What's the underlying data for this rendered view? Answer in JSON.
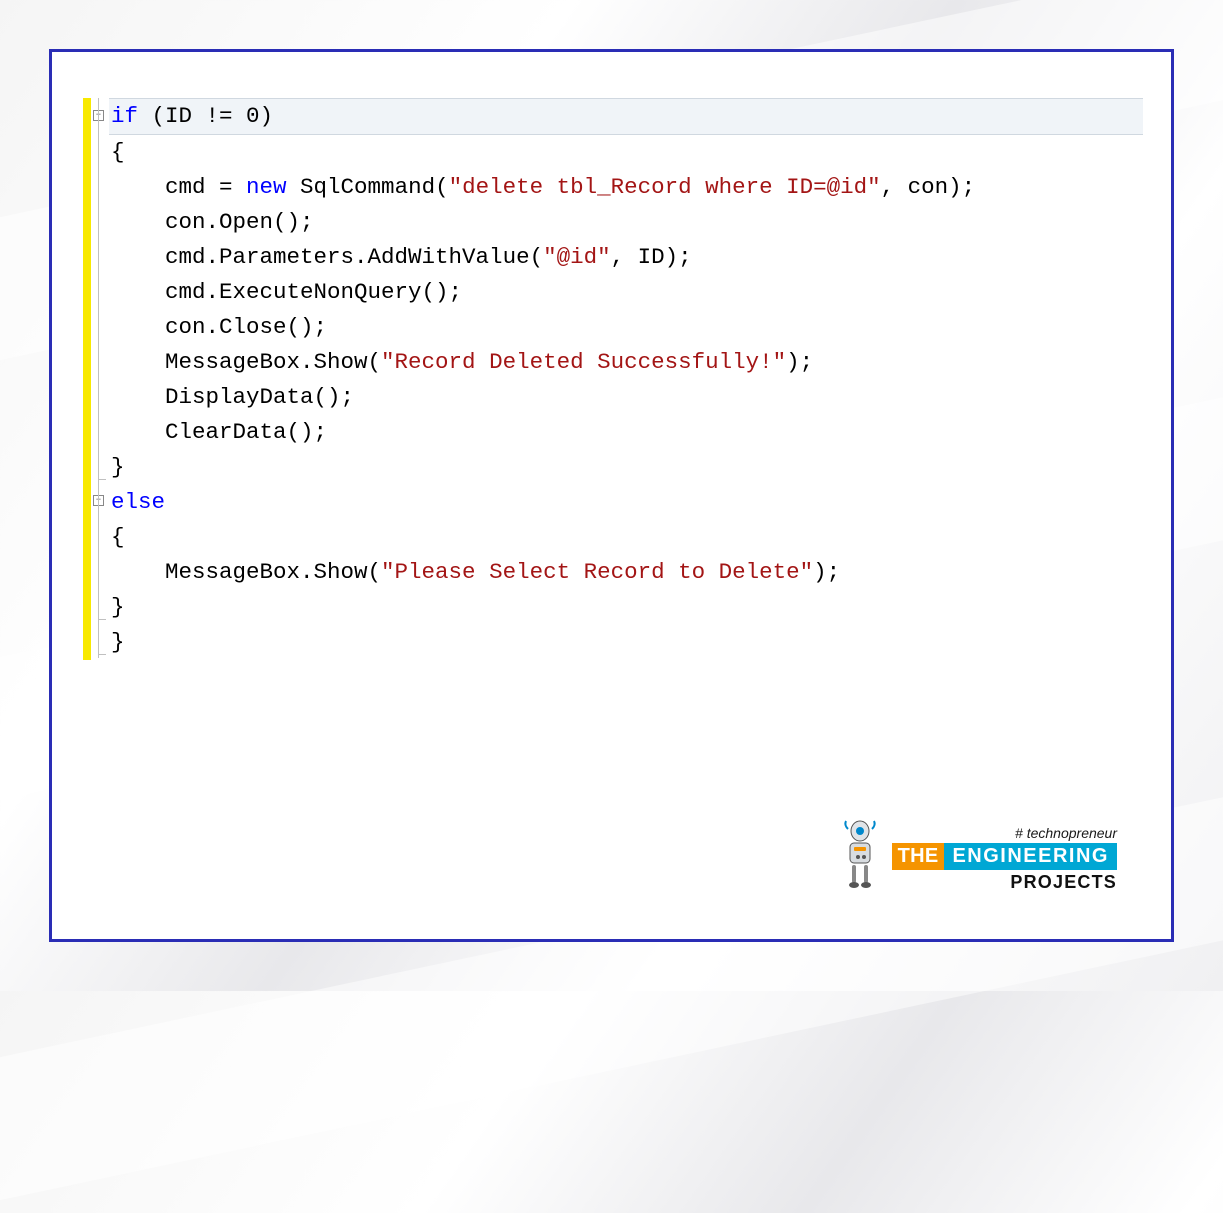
{
  "code": {
    "lines": [
      {
        "fold": "minus",
        "hl": true,
        "segs": [
          {
            "cls": "kw",
            "t": "if"
          },
          {
            "t": " (ID != 0)"
          }
        ]
      },
      {
        "segs": [
          {
            "t": "{"
          }
        ]
      },
      {
        "segs": [
          {
            "t": "    cmd = "
          },
          {
            "cls": "kw",
            "t": "new"
          },
          {
            "t": " SqlCommand("
          },
          {
            "cls": "str",
            "t": "\"delete tbl_Record where ID=@id\""
          },
          {
            "t": ", con);"
          }
        ]
      },
      {
        "segs": [
          {
            "t": "    con.Open();"
          }
        ]
      },
      {
        "segs": [
          {
            "t": "    cmd.Parameters.AddWithValue("
          },
          {
            "cls": "str",
            "t": "\"@id\""
          },
          {
            "t": ", ID);"
          }
        ]
      },
      {
        "segs": [
          {
            "t": "    cmd.ExecuteNonQuery();"
          }
        ]
      },
      {
        "segs": [
          {
            "t": "    con.Close();"
          }
        ]
      },
      {
        "segs": [
          {
            "t": "    MessageBox.Show("
          },
          {
            "cls": "str",
            "t": "\"Record Deleted Successfully!\""
          },
          {
            "t": ");"
          }
        ]
      },
      {
        "segs": [
          {
            "t": "    DisplayData();"
          }
        ]
      },
      {
        "segs": [
          {
            "t": "    ClearData();"
          }
        ]
      },
      {
        "segs": [
          {
            "t": "}"
          }
        ]
      },
      {
        "fold": "minus",
        "segs": [
          {
            "cls": "kw",
            "t": "else"
          }
        ]
      },
      {
        "segs": [
          {
            "t": "{"
          }
        ]
      },
      {
        "segs": [
          {
            "t": "    MessageBox.Show("
          },
          {
            "cls": "str",
            "t": "\"Please Select Record to Delete\""
          },
          {
            "t": ");"
          }
        ]
      },
      {
        "segs": [
          {
            "t": "}"
          }
        ]
      },
      {
        "segs": [
          {
            "t": "}"
          }
        ]
      }
    ]
  },
  "watermark": {
    "tagline": "# technopreneur",
    "the": "THE",
    "engineering": "ENGINEERING",
    "projects": "PROJECTS"
  }
}
